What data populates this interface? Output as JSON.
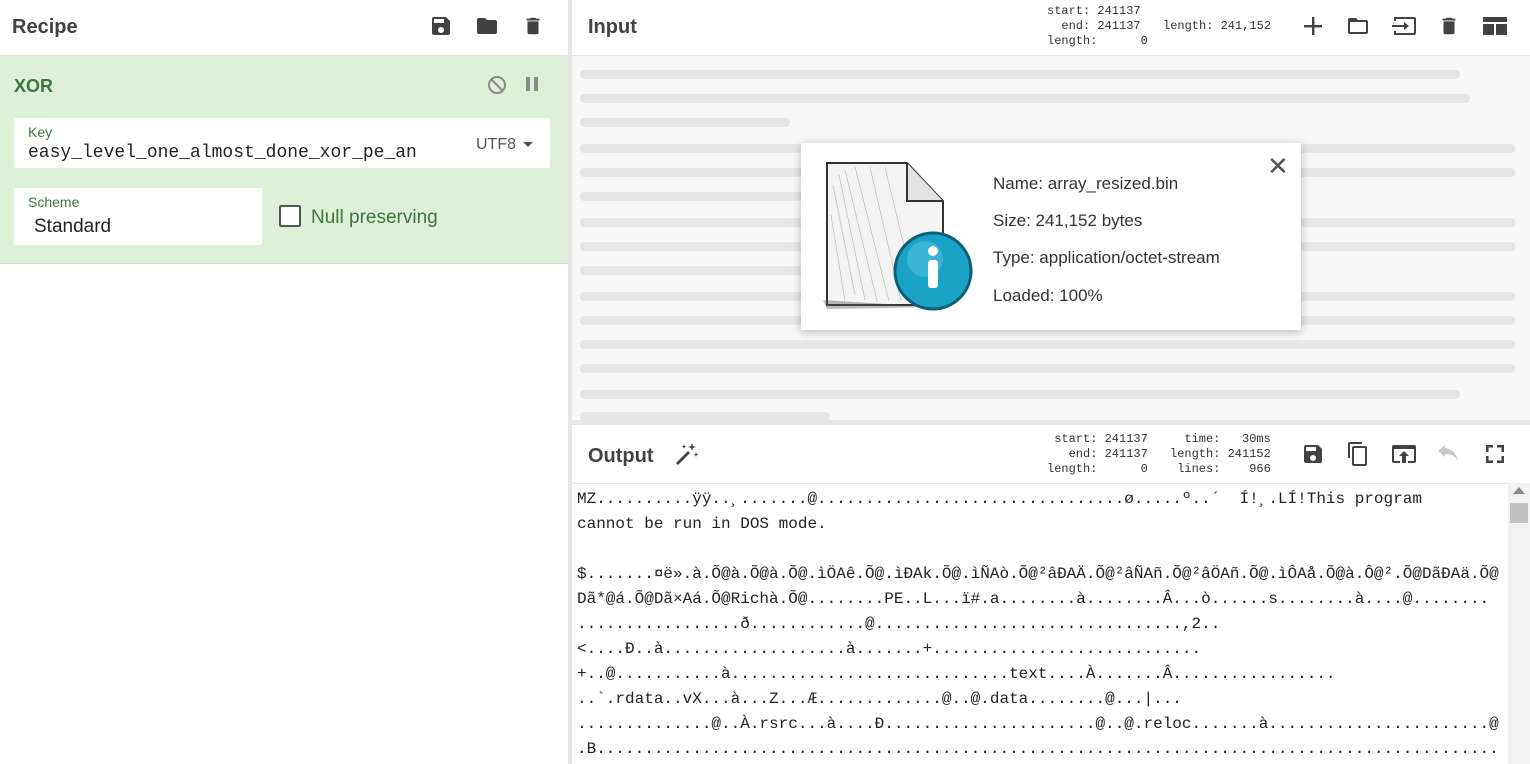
{
  "recipe": {
    "title": "Recipe",
    "operation": {
      "name": "XOR",
      "key": {
        "label": "Key",
        "value": "easy_level_one_almost_done_xor_pe_an",
        "encoding": "UTF8"
      },
      "scheme": {
        "label": "Scheme",
        "value": "Standard"
      },
      "null_preserving_label": "Null preserving",
      "null_preserving_checked": false
    }
  },
  "input": {
    "title": "Input",
    "stats": {
      "left": "start: 241137\n  end: 241137\nlength:      0",
      "right": "length: 241,152"
    }
  },
  "file_info": {
    "name": "Name: array_resized.bin",
    "size": "Size: 241,152 bytes",
    "type": "Type: application/octet-stream",
    "loaded": "Loaded: 100%"
  },
  "output": {
    "title": "Output",
    "stats": {
      "left": " start: 241137\n   end: 241137\nlength:      0",
      "right": "  time:   30ms\nlength: 241152\n lines:    966"
    },
    "text": "MZ..........ÿÿ..¸.......@................................ø.....º..´  Í!¸.LÍ!This program\ncannot be run in DOS mode.\n\n$.......¤ë».à.Õ@à.Õ@à.Õ@.ìÖAê.Õ@.ìÐAk.Õ@.ìÑAò.Õ@²âÐAÄ.Õ@²âÑAñ.Õ@²âÖAñ.Õ@.ìÔAå.Õ@à.Ô@².Õ@DãÐAä.Õ@\nDã*@á.Õ@Dã×Aá.Õ@Richà.Õ@........PE..L...ï#.a........à........Â...ò......s........à....@........\n.................ð............@................................,2..\n<....Ð..à...................à.......+............................\n+..@...........à.............................text....À.......Â.................\n..`.rdata..vX...à...Z...Æ.............@..@.data........@...|...\n..............@..À.rsrc...à....Ð......................@..@.reloc.......à.......................@.\n.B................................................................................................"
  }
}
